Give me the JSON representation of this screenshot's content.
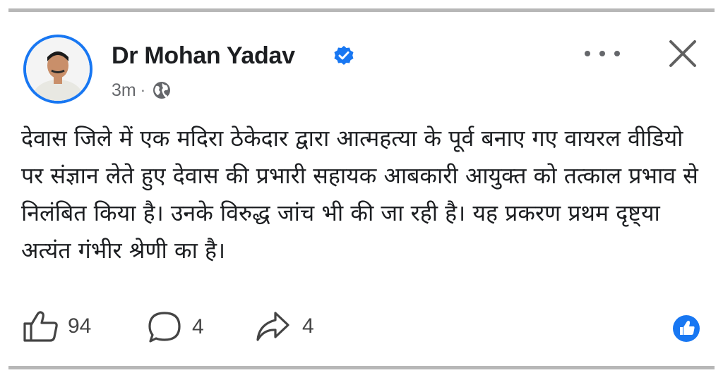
{
  "post": {
    "author": "Dr Mohan Yadav",
    "time": "3m",
    "separator": "·",
    "body": "देवास जिले में एक मदिरा ठेकेदार द्वारा आत्महत्या के पूर्व बनाए गए वायरल वीडियो पर संज्ञान लेते हुए देवास की प्रभारी सहायक आबकारी आयुक्त को तत्काल प्रभाव से निलंबित किया है। उनके विरुद्ध जांच भी की जा रही है। यह प्रकरण प्रथम दृष्ट्या अत्यंत गंभीर श्रेणी का है।"
  },
  "actions": {
    "likes": "94",
    "comments": "4",
    "shares": "4"
  },
  "icons": {
    "verified": "verified-badge-icon",
    "privacy": "globe-icon",
    "more": "more-options-icon",
    "close": "close-icon",
    "like": "thumbs-up-icon",
    "comment": "comment-bubble-icon",
    "share": "share-arrow-icon",
    "reaction": "like-reaction-icon"
  },
  "colors": {
    "accent": "#1877f2",
    "text": "#1c1e21",
    "muted": "#65676b",
    "rule": "#b7b7b7"
  }
}
